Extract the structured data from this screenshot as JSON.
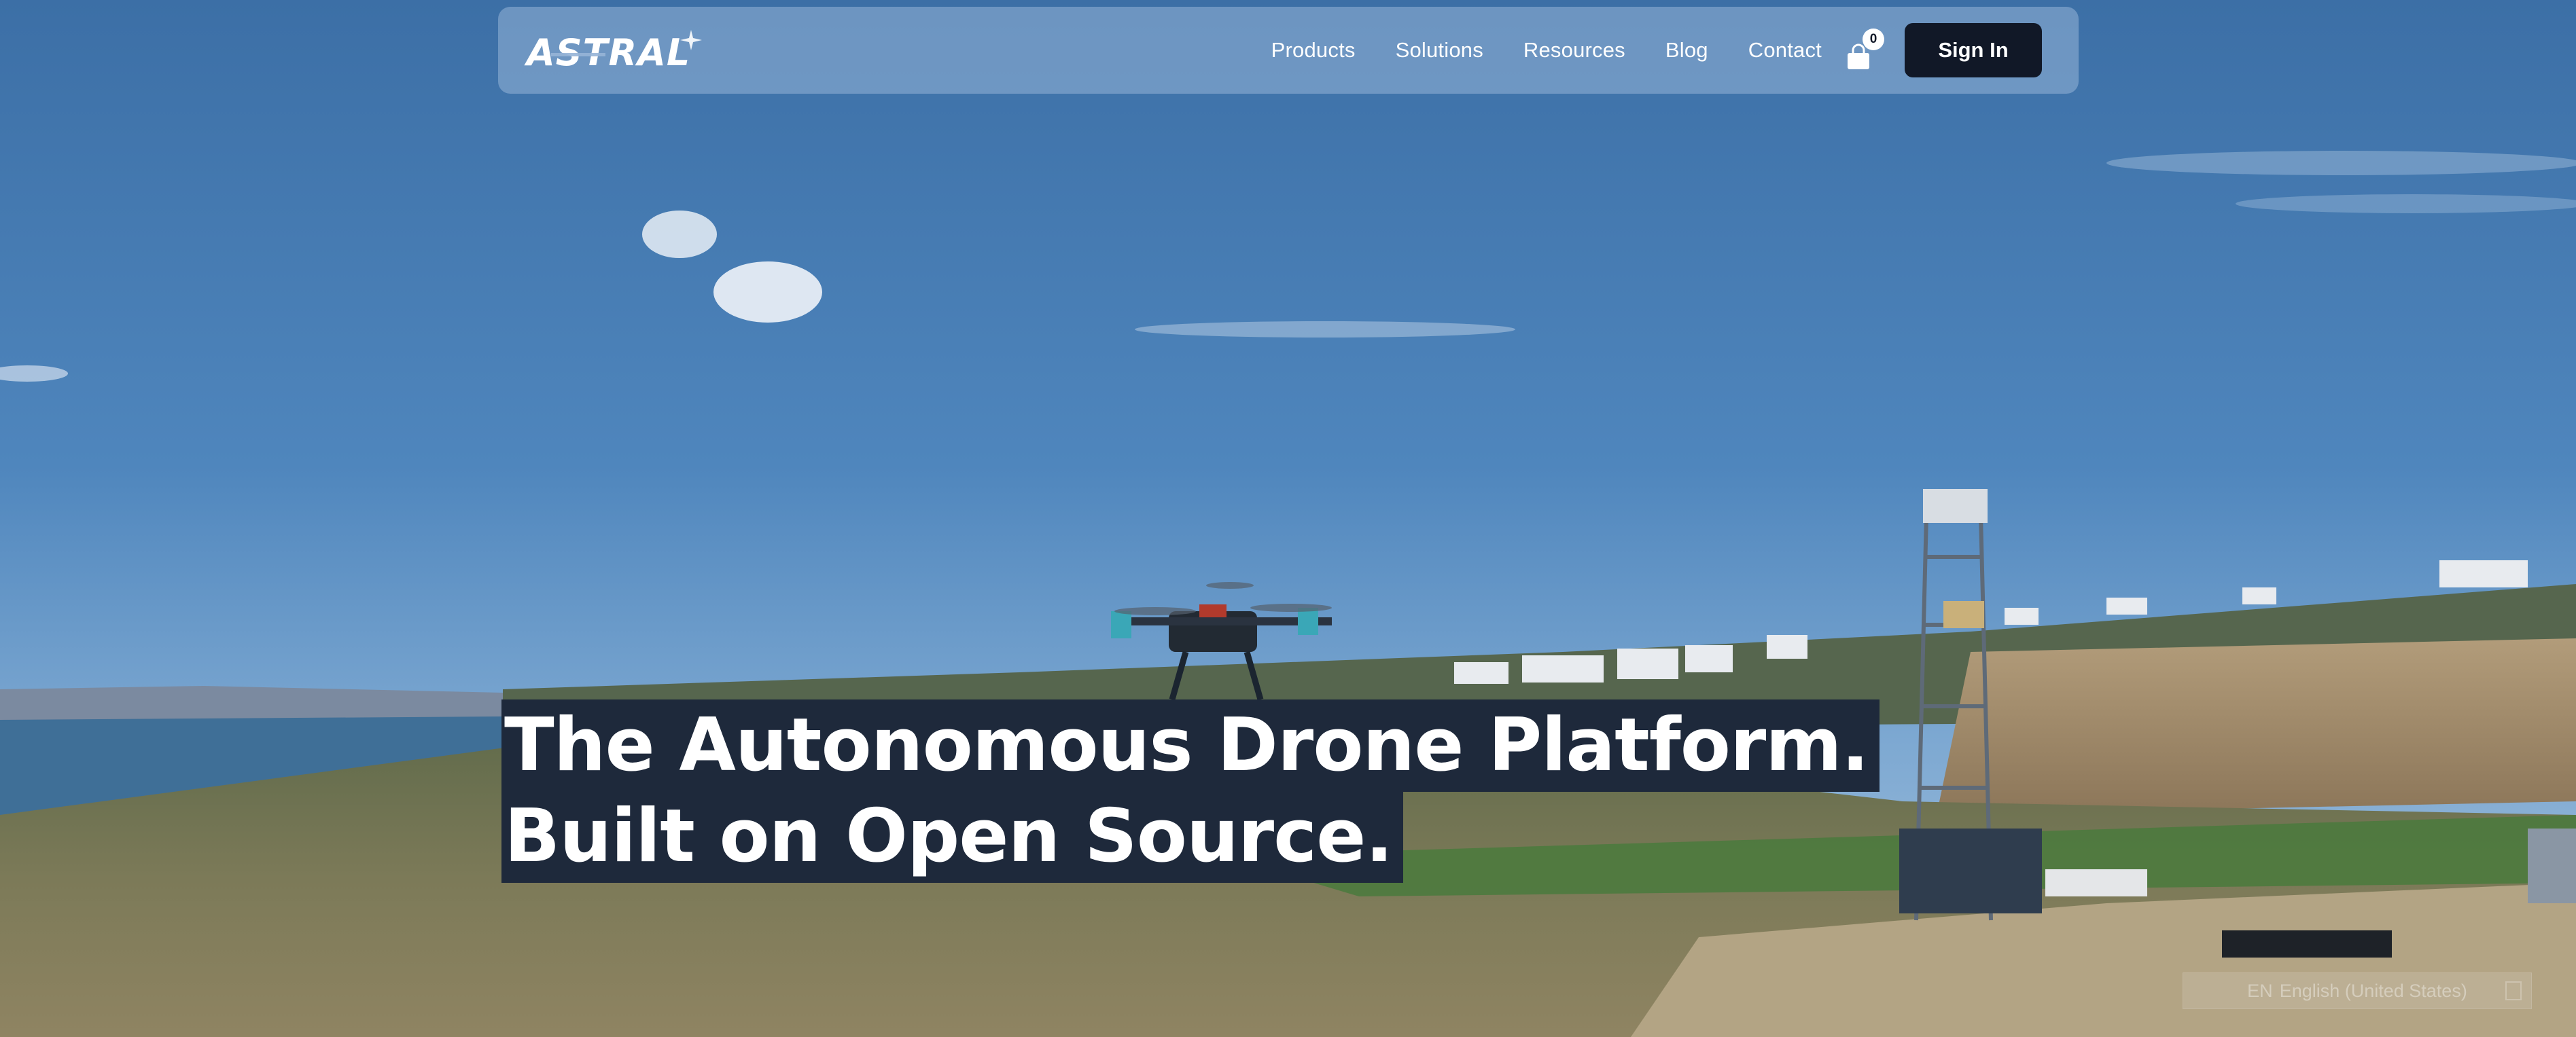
{
  "header": {
    "logo_text": "ASTRAL",
    "nav": [
      {
        "label": "Products"
      },
      {
        "label": "Solutions"
      },
      {
        "label": "Resources"
      },
      {
        "label": "Blog"
      },
      {
        "label": "Contact"
      }
    ],
    "cart": {
      "icon": "shopping-bag-icon",
      "count": "0"
    },
    "signin_label": "Sign In"
  },
  "hero": {
    "line1": "The Autonomous Drone Platform.",
    "line2": "Built on Open Source."
  },
  "language": {
    "code": "EN",
    "name": "English (United States)"
  },
  "colors": {
    "nav_bg": "#96b4d7",
    "button_bg": "#111827",
    "headline_bg": "#1e293b",
    "text": "#ffffff"
  }
}
